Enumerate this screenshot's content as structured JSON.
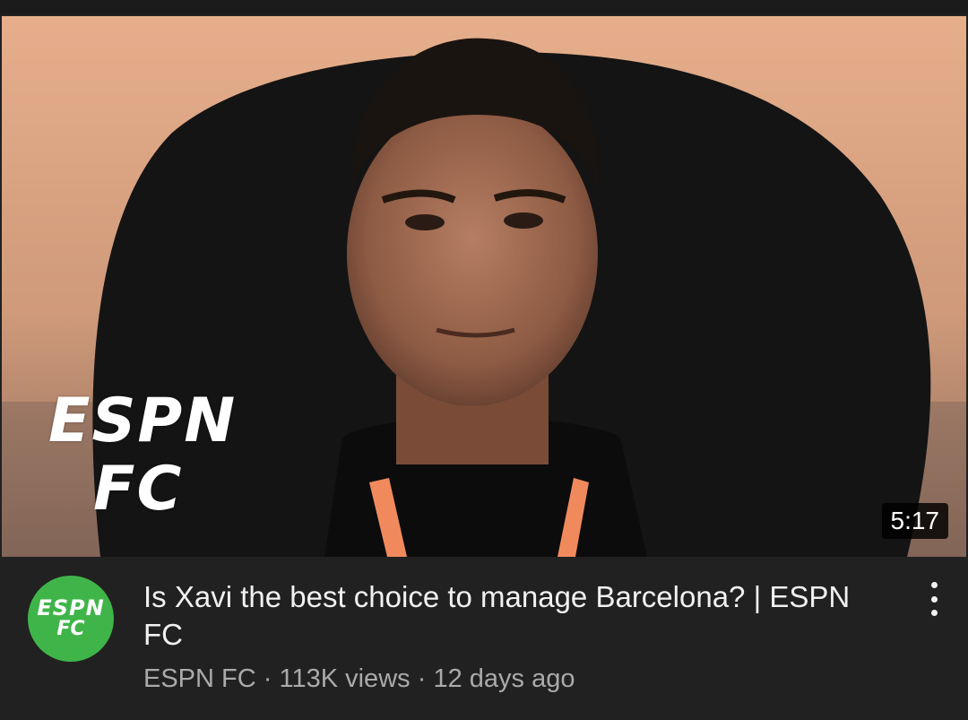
{
  "video": {
    "duration": "5:17",
    "thumbnail_logo": {
      "line1": "ESPN",
      "line2": "FC"
    }
  },
  "channel": {
    "avatar_line1": "ESPN",
    "avatar_line2": "FC",
    "avatar_color": "#3fb549"
  },
  "title": "Is Xavi the best choice to manage Barcelona? | ESPN FC",
  "meta": {
    "channel_name": "ESPN FC",
    "separator": "·",
    "views": "113K views",
    "age": "12 days ago"
  },
  "icons": {
    "menu": "more-vert-icon"
  }
}
